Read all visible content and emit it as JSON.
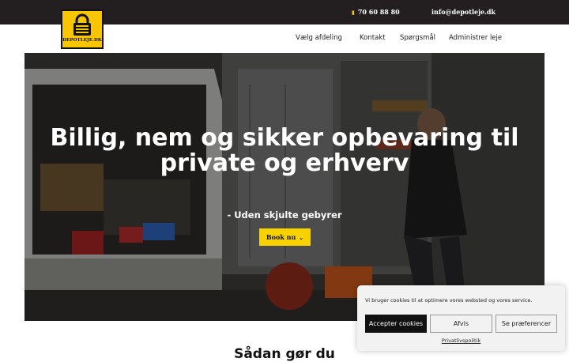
{
  "header": {
    "logo_text": "DEPOTLEJE.DK",
    "phone": "70 60 88 80",
    "phone_icon": "phone-icon",
    "email": "info@depotleje.dk"
  },
  "nav": {
    "items": [
      {
        "label": "Vælg afdeling"
      },
      {
        "label": "Kontakt"
      },
      {
        "label": "Spørgsmål"
      },
      {
        "label": "Administrer leje"
      }
    ]
  },
  "hero": {
    "title": "Billig, nem og sikker opbevaring til private og erhverv",
    "subtitle": "- Uden skjulte gebyrer",
    "book_label": "Book nu",
    "book_icon": "chevron-down-icon"
  },
  "section": {
    "title": "Sådan gør du"
  },
  "cookie": {
    "text": "Vi bruger cookies til at optimere vores websted og vores service.",
    "accept_label": "Accepter cookies",
    "reject_label": "Afvis",
    "prefs_label": "Se præferencer",
    "privacy_label": "Privatlivspolitik"
  },
  "colors": {
    "topbar": "#231f20",
    "accent": "#f7c600",
    "button": "#f7d100"
  }
}
